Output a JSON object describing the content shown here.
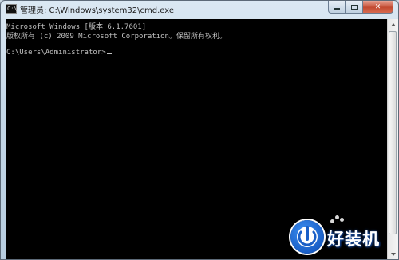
{
  "window": {
    "title_icon_text": "C:\\",
    "title": "管理员: C:\\Windows\\system32\\cmd.exe"
  },
  "console": {
    "lines": [
      "Microsoft Windows [版本 6.1.7601]",
      "版权所有 (c) 2009 Microsoft Corporation。保留所有权利。",
      "",
      "C:\\Users\\Administrator>"
    ]
  },
  "watermark": {
    "text": "好装机"
  },
  "colors": {
    "console_bg": "#000000",
    "console_text": "#c0c0c0",
    "close_button": "#c24a31",
    "watermark_blue": "#1a5fc7"
  },
  "icons": {
    "title": "cmd-icon",
    "minimize": "minimize-icon",
    "maximize": "maximize-icon",
    "close": "close-icon",
    "watermark_logo": "haozhuangji-logo"
  }
}
